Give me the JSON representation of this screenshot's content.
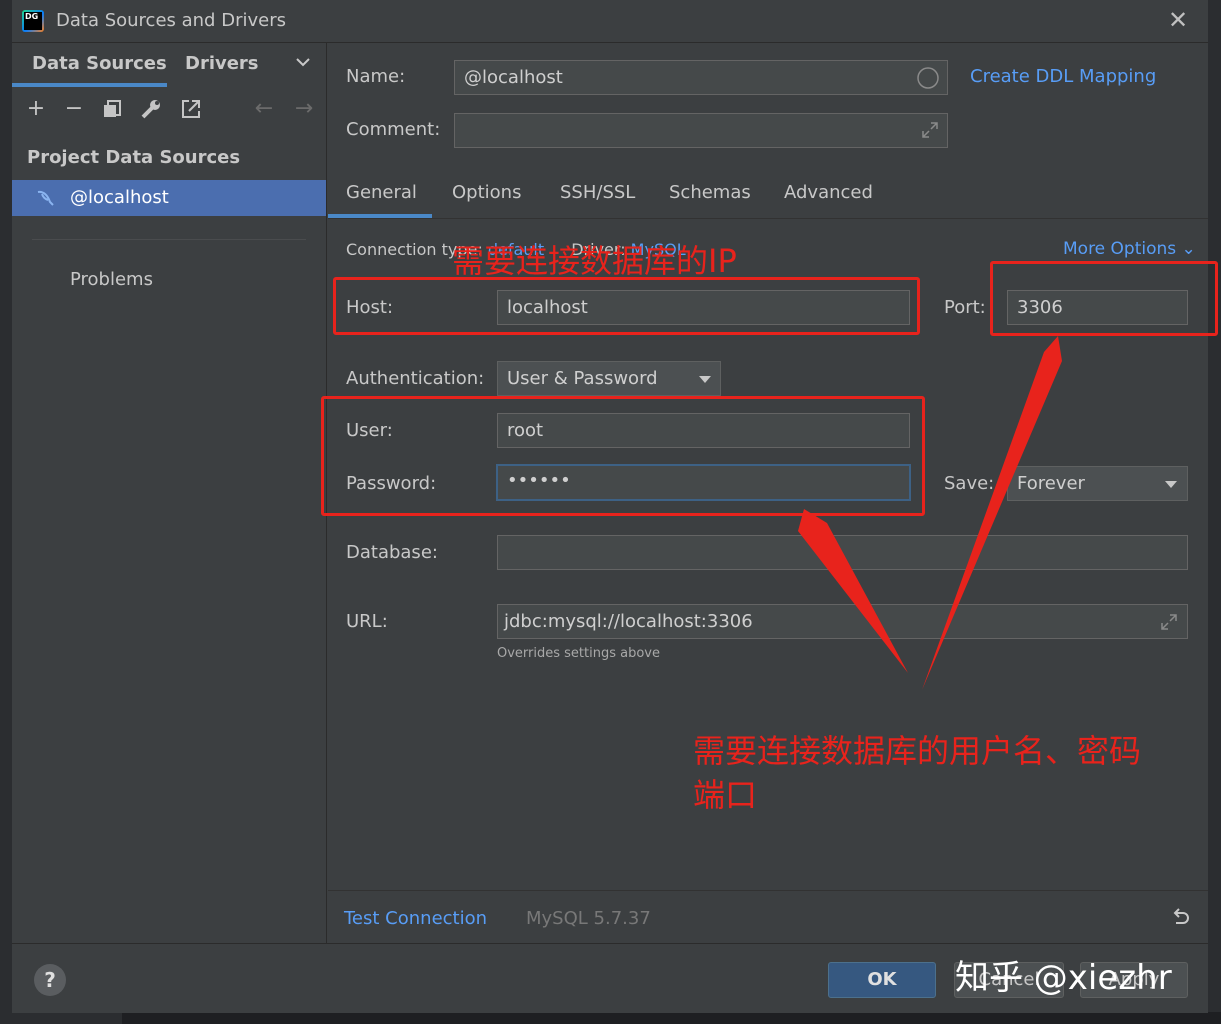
{
  "window": {
    "title": "Data Sources and Drivers",
    "app_icon_text": "DG"
  },
  "left_panel": {
    "tabs": [
      "Data Sources",
      "Drivers"
    ],
    "heading": "Project Data Sources",
    "items": [
      {
        "label": "@localhost"
      }
    ],
    "problems": "Problems"
  },
  "form": {
    "name_label": "Name:",
    "name_value": "@localhost",
    "comment_label": "Comment:",
    "comment_value": "",
    "create_ddl_link": "Create DDL Mapping",
    "tabs": [
      "General",
      "Options",
      "SSH/SSL",
      "Schemas",
      "Advanced"
    ],
    "active_tab": "General",
    "connection_type_label": "Connection type:",
    "connection_type_value": "default",
    "driver_label": "Driver:",
    "driver_value": "MySQL",
    "more_options": "More Options",
    "host_label": "Host:",
    "host_value": "localhost",
    "port_label": "Port:",
    "port_value": "3306",
    "auth_label": "Authentication:",
    "auth_value": "User & Password",
    "user_label": "User:",
    "user_value": "root",
    "password_label": "Password:",
    "password_value": "••••••",
    "save_label": "Save:",
    "save_value": "Forever",
    "database_label": "Database:",
    "database_value": "",
    "url_label": "URL:",
    "url_value": "jdbc:mysql://localhost:3306",
    "url_hint": "Overrides settings above"
  },
  "footer": {
    "test_connection": "Test Connection",
    "server_version": "MySQL 5.7.37"
  },
  "buttons": {
    "help": "?",
    "ok": "OK",
    "cancel": "Cancel",
    "apply": "Apply"
  },
  "annotations": {
    "ip_note": "需要连接数据库的IP",
    "cred_note_line1": "需要连接数据库的用户名、密码",
    "cred_note_line2": "端口"
  },
  "watermark": "知乎 @xiezhr",
  "colors": {
    "annotation": "#e8231c",
    "link": "#589df6",
    "selection": "#4b6eaf"
  }
}
